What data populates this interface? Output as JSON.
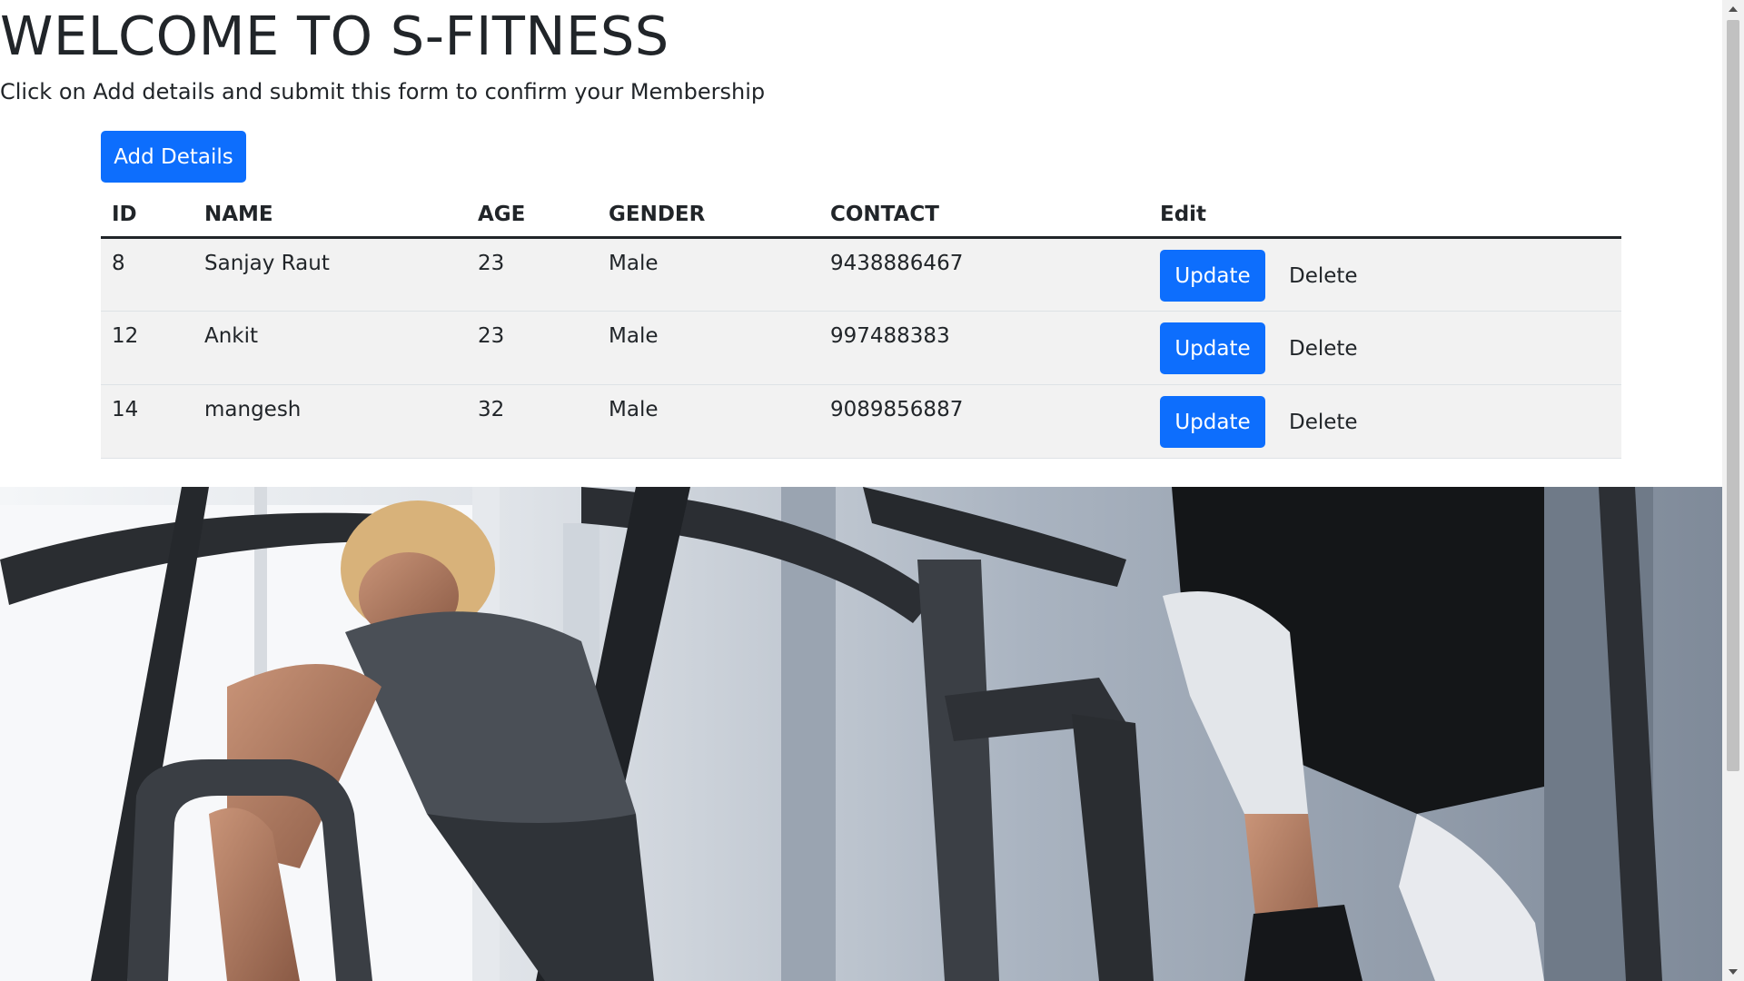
{
  "header": {
    "title": "WELCOME TO S-FITNESS",
    "subtitle": "Click on Add details and submit this form to confirm your Membership"
  },
  "actions": {
    "add_label": "Add Details"
  },
  "table": {
    "columns": [
      "ID",
      "NAME",
      "AGE",
      "GENDER",
      "CONTACT",
      "Edit"
    ],
    "rows": [
      {
        "id": "8",
        "name": "Sanjay Raut",
        "age": "23",
        "gender": "Male",
        "contact": "9438886467",
        "update_label": "Update",
        "delete_label": "Delete"
      },
      {
        "id": "12",
        "name": "Ankit",
        "age": "23",
        "gender": "Male",
        "contact": "997488383",
        "update_label": "Update",
        "delete_label": "Delete"
      },
      {
        "id": "14",
        "name": "mangesh",
        "age": "32",
        "gender": "Male",
        "contact": "9089856887",
        "update_label": "Update",
        "delete_label": "Delete"
      }
    ]
  },
  "hero": {
    "icon": "gym-treadmill-photo"
  },
  "colors": {
    "primary": "#0d6efd",
    "row_stripe": "#f2f2f2",
    "text": "#212529"
  }
}
